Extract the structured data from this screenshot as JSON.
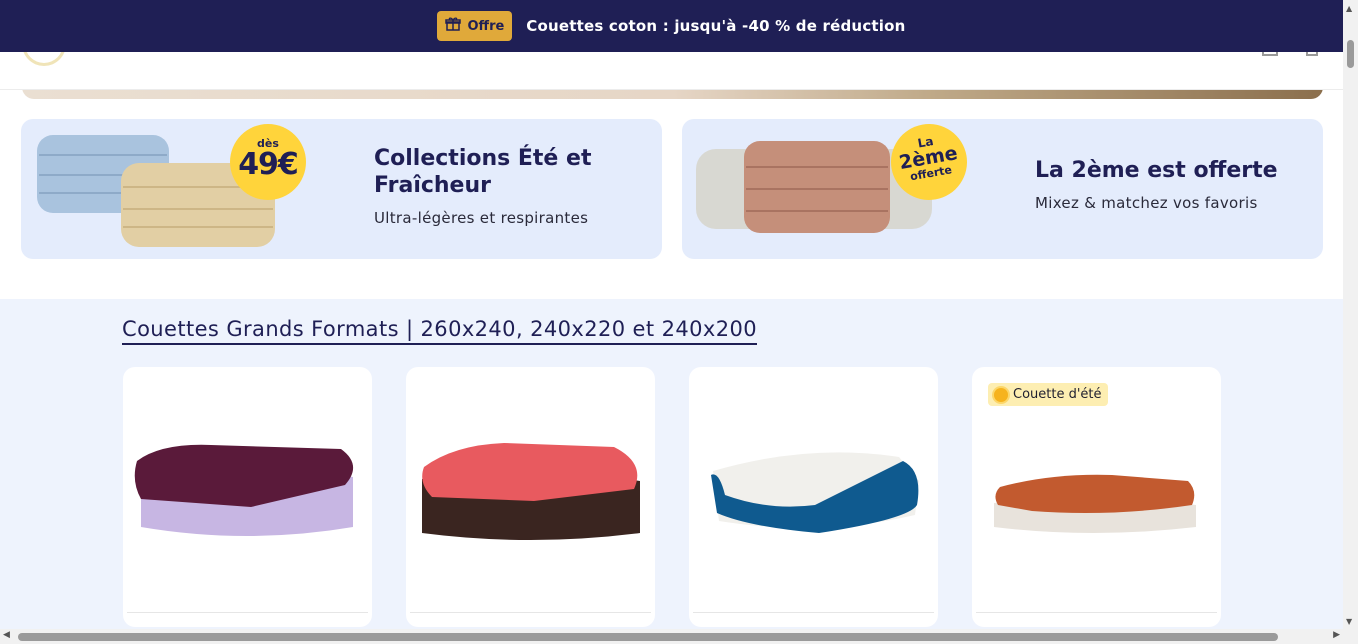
{
  "announcement": {
    "badge_label": "Offre",
    "badge_icon": "gift-icon",
    "text": "Couettes coton : jusqu'à -40 % de réduction"
  },
  "promos": [
    {
      "badge_small": "dès",
      "badge_big": "49€",
      "title_line1": "Collections Été et",
      "title_line2": "Fraîcheur",
      "subtitle": "Ultra-légères et respirantes"
    },
    {
      "badge_l1": "La",
      "badge_l2": "2ème",
      "badge_l3": "offerte",
      "title": "La 2ème est offerte",
      "subtitle": "Mixez & matchez vos favoris"
    }
  ],
  "section": {
    "title": "Couettes Grands Formats | 260x240, 240x220 et 240x200"
  },
  "products": [
    {
      "colors": {
        "top": "#5a1a3a",
        "bottom": "#c7b6e3"
      }
    },
    {
      "colors": {
        "top": "#e85a5f",
        "bottom": "#3a2520"
      }
    },
    {
      "colors": {
        "top": "#f1f0ec",
        "bottom": "#0f5a8f"
      }
    },
    {
      "tag": "Couette d'été",
      "tag_icon": "sun-icon",
      "colors": {
        "top": "#c25a2f",
        "bottom": "#e8e3dc"
      }
    }
  ]
}
